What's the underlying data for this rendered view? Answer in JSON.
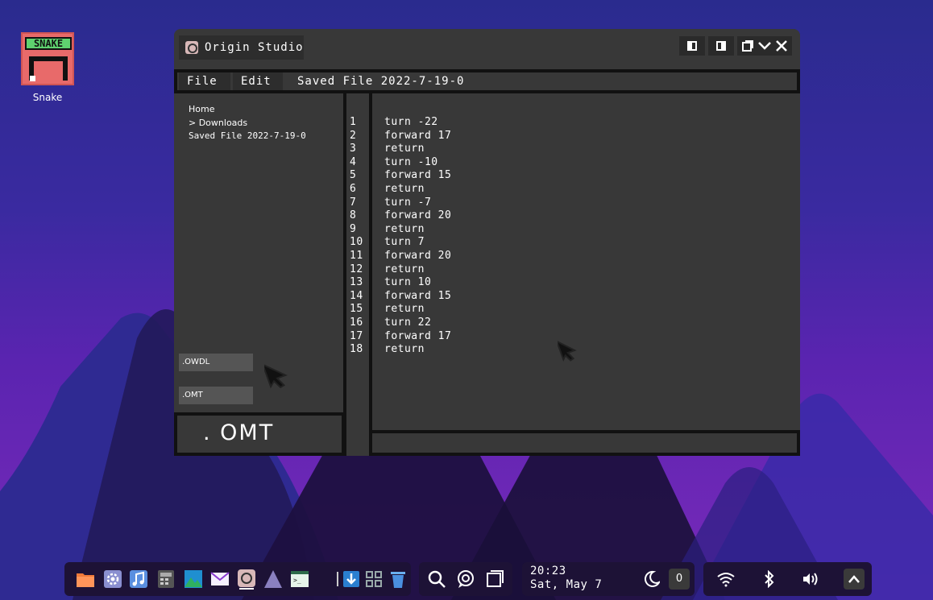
{
  "desktop": {
    "icons": [
      {
        "label": "Snake",
        "banner": "SNAKE",
        "icon": "snake-game-icon"
      }
    ]
  },
  "window": {
    "title": "Origin Studio",
    "controls": [
      "split-left-icon",
      "split-right-icon",
      "restore-icon",
      "minimize-chevron-icon",
      "close-icon"
    ],
    "menu": {
      "file": "File",
      "edit": "Edit",
      "open_file": "Saved File 2022-7-19-0"
    },
    "sidebar": {
      "tree": [
        "Home",
        "> Downloads",
        "Saved File 2022-7-19-0"
      ],
      "buttons": [
        ".OWDL",
        ".OMT"
      ],
      "extension": ". OMT"
    },
    "editor": {
      "line_numbers": [
        "1",
        "2",
        "3",
        "4",
        "5",
        "6",
        "7",
        "8",
        "9",
        "10",
        "11",
        "12",
        "13",
        "14",
        "15",
        "16",
        "17",
        "18"
      ],
      "lines": [
        "turn -22",
        "forward 17",
        "return",
        "turn -10",
        "forward 15",
        "return",
        "turn -7",
        "forward 20",
        "return",
        "turn 7",
        "forward 20",
        "return",
        "turn 10",
        "forward 15",
        "return",
        "turn 22",
        "forward 17",
        "return"
      ]
    }
  },
  "taskbar": {
    "apps": [
      "files-icon",
      "settings-icon",
      "music-icon",
      "calculator-icon",
      "photos-icon",
      "mail-icon",
      "origin-studio-icon",
      "triangle-app-icon",
      "terminal-icon",
      "install-icon",
      "apps-grid-icon",
      "trash-icon"
    ],
    "system": [
      "search-icon",
      "assistant-icon",
      "windows-icon"
    ],
    "clock": {
      "time": "20:23",
      "date": "Sat, May 7"
    },
    "notifications_count": "0",
    "tray": [
      "wifi-icon",
      "bluetooth-icon",
      "volume-icon",
      "expand-up-icon"
    ]
  }
}
